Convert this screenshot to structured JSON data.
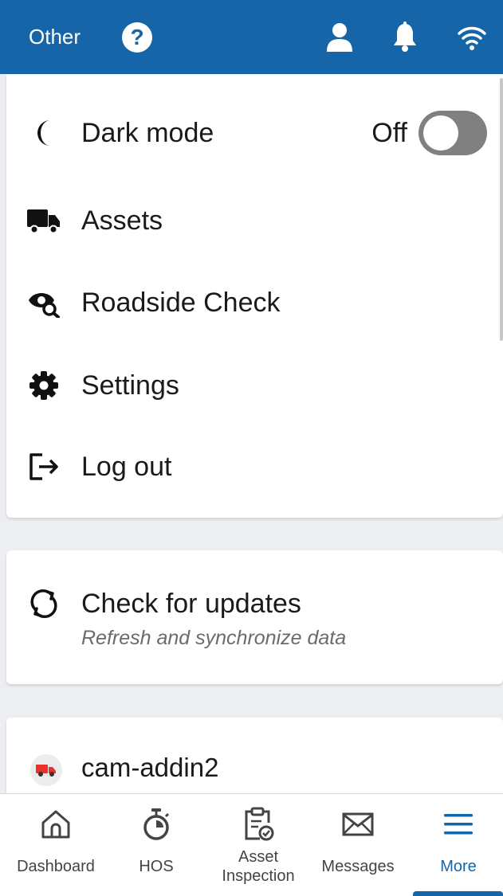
{
  "colors": {
    "header_bg": "#1565a8",
    "active": "#1565a8",
    "toggle_off": "#808080"
  },
  "header": {
    "title": "Other",
    "icons": [
      "help-icon",
      "user-icon",
      "bell-icon",
      "wifi-icon"
    ]
  },
  "menu": {
    "dark_mode": {
      "label": "Dark mode",
      "state": "Off",
      "on": false
    },
    "items": [
      {
        "label": "Assets",
        "icon": "truck-icon"
      },
      {
        "label": "Roadside Check",
        "icon": "eye-search-icon"
      },
      {
        "label": "Settings",
        "icon": "gear-icon"
      },
      {
        "label": "Log out",
        "icon": "logout-icon"
      }
    ]
  },
  "updates": {
    "title": "Check for updates",
    "subtitle": "Refresh and synchronize data"
  },
  "asset": {
    "name": "cam-addin2"
  },
  "nav": {
    "items": [
      {
        "label": "Dashboard",
        "icon": "home-icon"
      },
      {
        "label": "HOS",
        "icon": "stopwatch-icon"
      },
      {
        "label": "Asset Inspection",
        "icon": "clipboard-check-icon"
      },
      {
        "label": "Messages",
        "icon": "envelope-icon"
      },
      {
        "label": "More",
        "icon": "menu-icon",
        "active": true
      }
    ]
  }
}
